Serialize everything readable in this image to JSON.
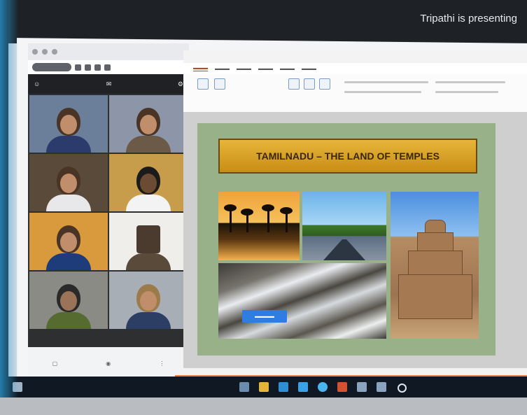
{
  "header": {
    "presenting_text": "Tripathi is presenting"
  },
  "slide": {
    "title": "TAMILNADU – THE LAND OF TEMPLES",
    "photos": [
      "palm-sunset",
      "country-road",
      "waterfall",
      "rock-temple"
    ]
  },
  "colors": {
    "slide_background": "#98b188",
    "title_banner": "#e1a52c",
    "taskbar": "#101923",
    "accent_orange": "#e96b27"
  },
  "meet": {
    "participant_count": 8
  },
  "taskbar": {
    "icons": [
      "start-icon",
      "search-icon",
      "file-explorer-icon",
      "edge-icon",
      "store-icon",
      "chrome-icon",
      "powerpoint-icon",
      "mail-icon",
      "circle-icon"
    ]
  }
}
